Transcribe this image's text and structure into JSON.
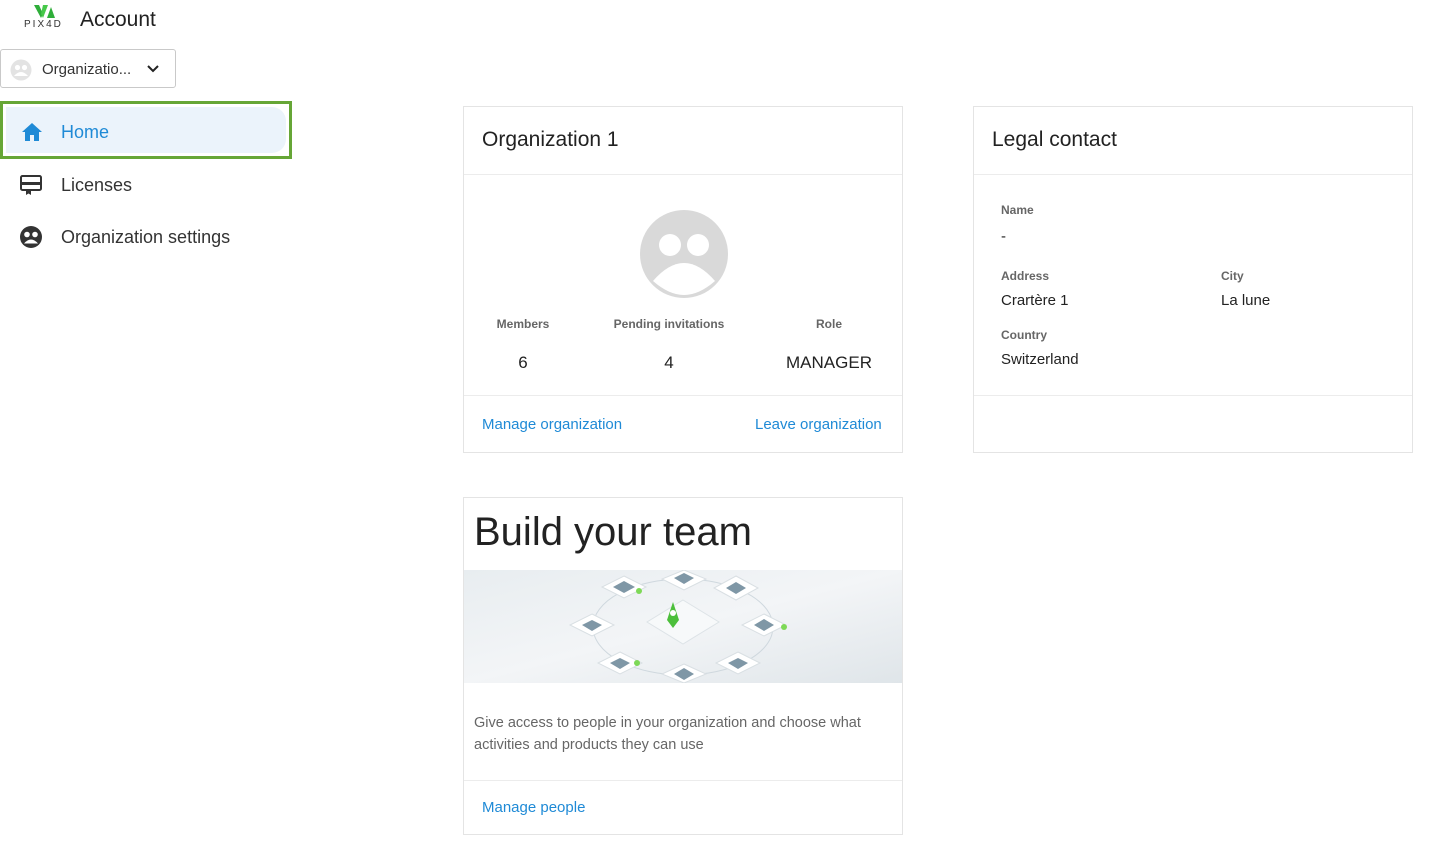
{
  "header": {
    "logo_text": "PIX4D",
    "title": "Account"
  },
  "org_selector": {
    "value": "Organizatio..."
  },
  "sidebar": {
    "items": [
      {
        "label": "Home",
        "icon": "home-icon",
        "active": true
      },
      {
        "label": "Licenses",
        "icon": "license-icon",
        "active": false
      },
      {
        "label": "Organization settings",
        "icon": "organization-icon",
        "active": false
      }
    ]
  },
  "organization_card": {
    "title": "Organization 1",
    "stats": [
      {
        "label": "Members",
        "value": "6"
      },
      {
        "label": "Pending invitations",
        "value": "4"
      },
      {
        "label": "Role",
        "value": "MANAGER"
      }
    ],
    "manage_link": "Manage organization",
    "leave_link": "Leave organization"
  },
  "legal_card": {
    "title": "Legal contact",
    "name_label": "Name",
    "name_value": "-",
    "address_label": "Address",
    "address_value": "Crartère 1",
    "city_label": "City",
    "city_value": "La lune",
    "country_label": "Country",
    "country_value": "Switzerland"
  },
  "team_card": {
    "title": "Build your team",
    "description": "Give access to people in your organization and choose what activities and products they can use",
    "manage_link": "Manage people"
  },
  "colors": {
    "accent": "#1f8ad6",
    "active_bg": "#ebf3fb",
    "highlight_border": "#66a636",
    "brand_green": "#3dbf3d"
  }
}
